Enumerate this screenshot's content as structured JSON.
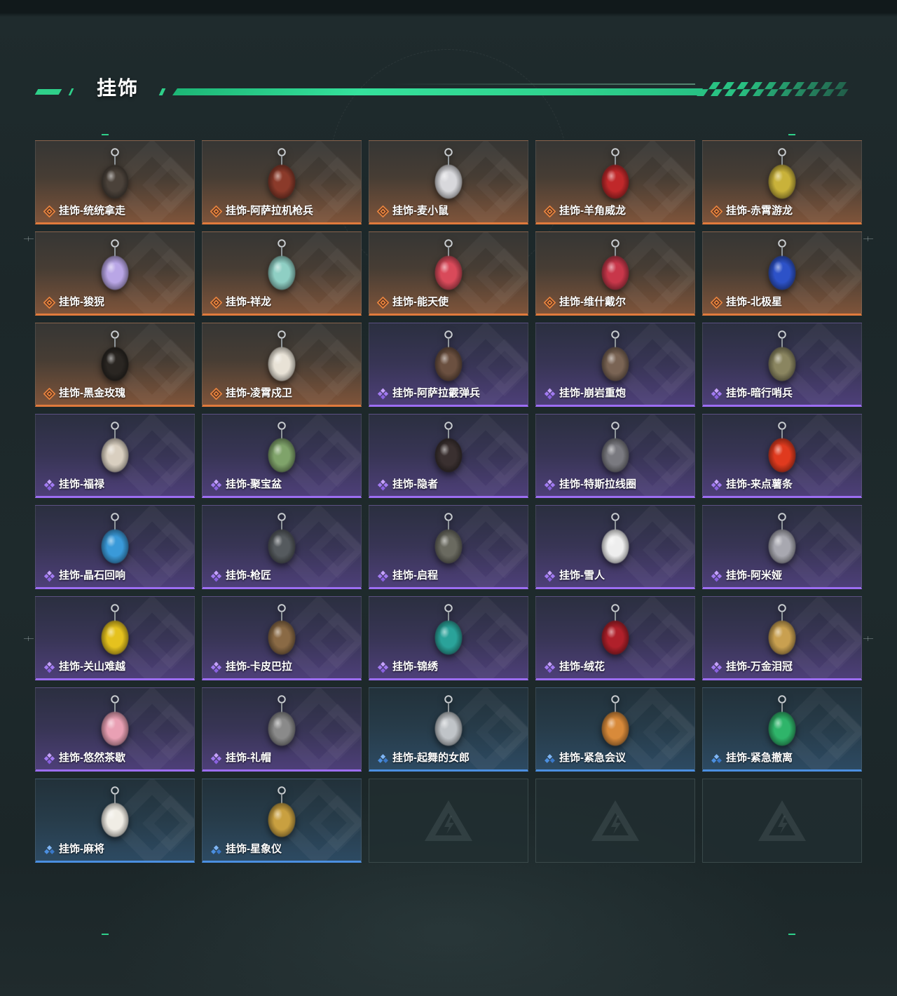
{
  "section": {
    "title": "挂饰"
  },
  "colors": {
    "accent": "#2fd08a",
    "legendary": "#e07a3c",
    "epic": "#9c6df2",
    "rare": "#4b8fe0"
  },
  "icons": {
    "legendary": "legendary-rarity-icon",
    "epic": "epic-rarity-icon",
    "rare": "rare-rarity-icon",
    "empty_slot": "logo-icon"
  },
  "items": [
    {
      "name": "挂饰-统统拿走",
      "rarity": "legendary",
      "color": "#4b423a"
    },
    {
      "name": "挂饰-阿萨拉机枪兵",
      "rarity": "legendary",
      "color": "#8b3a2a"
    },
    {
      "name": "挂饰-麦小鼠",
      "rarity": "legendary",
      "color": "#d8d8dc"
    },
    {
      "name": "挂饰-羊角威龙",
      "rarity": "legendary",
      "color": "#c0282a"
    },
    {
      "name": "挂饰-赤霄游龙",
      "rarity": "legendary",
      "color": "#c9b23a"
    },
    {
      "name": "挂饰-狻猊",
      "rarity": "legendary",
      "color": "#b9a6e6"
    },
    {
      "name": "挂饰-祥龙",
      "rarity": "legendary",
      "color": "#8fcfc4"
    },
    {
      "name": "挂饰-能天使",
      "rarity": "legendary",
      "color": "#d94a5a"
    },
    {
      "name": "挂饰-维什戴尔",
      "rarity": "legendary",
      "color": "#c8374a"
    },
    {
      "name": "挂饰-北极星",
      "rarity": "legendary",
      "color": "#2d52c8"
    },
    {
      "name": "挂饰-黑金玫瑰",
      "rarity": "legendary",
      "color": "#2a2622"
    },
    {
      "name": "挂饰-凌霄戍卫",
      "rarity": "legendary",
      "color": "#e8e2d6"
    },
    {
      "name": "挂饰-阿萨拉霰弹兵",
      "rarity": "epic",
      "color": "#6b5040"
    },
    {
      "name": "挂饰-崩岩重炮",
      "rarity": "epic",
      "color": "#7a6454"
    },
    {
      "name": "挂饰-暗行哨兵",
      "rarity": "epic",
      "color": "#8a8560"
    },
    {
      "name": "挂饰-福禄",
      "rarity": "epic",
      "color": "#d9cfc0"
    },
    {
      "name": "挂饰-聚宝盆",
      "rarity": "epic",
      "color": "#7fa36a"
    },
    {
      "name": "挂饰-隐者",
      "rarity": "epic",
      "color": "#3a3030"
    },
    {
      "name": "挂饰-特斯拉线圈",
      "rarity": "epic",
      "color": "#7a7a80"
    },
    {
      "name": "挂饰-来点薯条",
      "rarity": "epic",
      "color": "#e03a1e"
    },
    {
      "name": "挂饰-晶石回响",
      "rarity": "epic",
      "color": "#3a9ad9"
    },
    {
      "name": "挂饰-枪匠",
      "rarity": "epic",
      "color": "#555a5e"
    },
    {
      "name": "挂饰-启程",
      "rarity": "epic",
      "color": "#6a6a60"
    },
    {
      "name": "挂饰-雪人",
      "rarity": "epic",
      "color": "#eeeeee"
    },
    {
      "name": "挂饰-阿米娅",
      "rarity": "epic",
      "color": "#a8a8b0"
    },
    {
      "name": "挂饰-关山难越",
      "rarity": "epic",
      "color": "#e5c21e"
    },
    {
      "name": "挂饰-卡皮巴拉",
      "rarity": "epic",
      "color": "#8a6a45"
    },
    {
      "name": "挂饰-锦绣",
      "rarity": "epic",
      "color": "#2aa39a"
    },
    {
      "name": "挂饰-绒花",
      "rarity": "epic",
      "color": "#b0202a"
    },
    {
      "name": "挂饰-万金泪冠",
      "rarity": "epic",
      "color": "#c9a050"
    },
    {
      "name": "挂饰-悠然茶歇",
      "rarity": "epic",
      "color": "#e9a0b4"
    },
    {
      "name": "挂饰-礼帽",
      "rarity": "epic",
      "color": "#8a8a8a"
    },
    {
      "name": "挂饰-起舞的女郎",
      "rarity": "rare",
      "color": "#c0c4c8"
    },
    {
      "name": "挂饰-紧急会议",
      "rarity": "rare",
      "color": "#d88a3a"
    },
    {
      "name": "挂饰-紧急撤离",
      "rarity": "rare",
      "color": "#2fb56a"
    },
    {
      "name": "挂饰-麻将",
      "rarity": "rare",
      "color": "#f0ede5"
    },
    {
      "name": "挂饰-星象仪",
      "rarity": "rare",
      "color": "#c9a040"
    }
  ]
}
